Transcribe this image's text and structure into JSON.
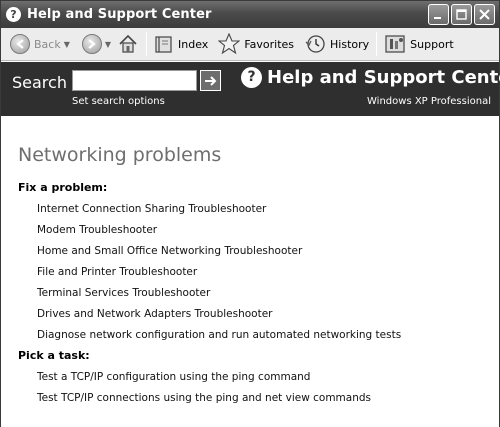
{
  "window": {
    "title": "Help and Support Center"
  },
  "toolbar": {
    "back": "Back",
    "index": "Index",
    "favorites": "Favorites",
    "history": "History",
    "support": "Support"
  },
  "header": {
    "search_label": "Search",
    "search_value": "",
    "search_options": "Set search options",
    "title": "Help and Support Center",
    "edition": "Windows XP Professional"
  },
  "content": {
    "title": "Networking problems",
    "sections": [
      {
        "heading": "Fix a problem:",
        "links": [
          "Internet Connection Sharing Troubleshooter",
          "Modem Troubleshooter",
          "Home and Small Office Networking Troubleshooter",
          "File and Printer Troubleshooter",
          "Terminal Services Troubleshooter",
          "Drives and Network Adapters Troubleshooter",
          "Diagnose network configuration and run automated networking tests"
        ]
      },
      {
        "heading": "Pick a task:",
        "links": [
          "Test a TCP/IP configuration using the ping command",
          "Test TCP/IP connections using the ping and net view commands"
        ]
      }
    ]
  }
}
